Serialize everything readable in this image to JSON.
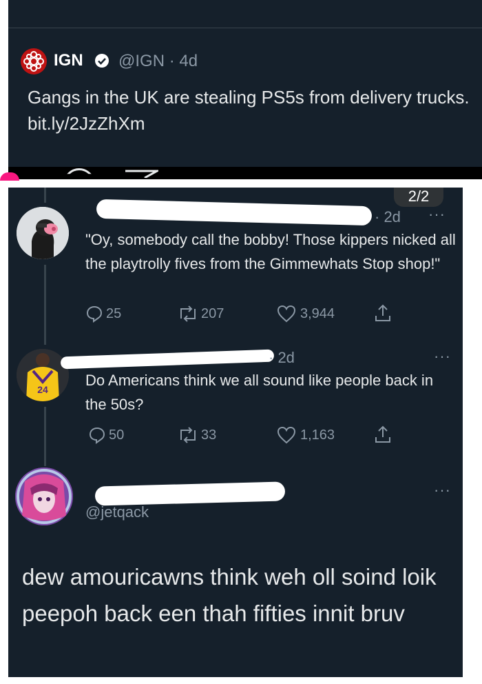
{
  "top_tweet": {
    "name": "IGN",
    "handle_time": "@IGN · 4d",
    "text": "Gangs in the UK are stealing PS5s from delivery trucks. bit.ly/2JzZhXm"
  },
  "page_counter": "2/2",
  "reply1": {
    "time": "· 2d",
    "text": "\"Oy, somebody call the bobby! Those kippers nicked all the playtrolly fives from the Gimmewhats Stop shop!\"",
    "replies": "25",
    "retweets": "207",
    "likes": "3,944"
  },
  "reply2": {
    "time": "· 2d",
    "jersey": "24",
    "text": "Do Americans think we all sound like people back in the 50s?",
    "replies": "50",
    "retweets": "33",
    "likes": "1,163"
  },
  "reply3": {
    "handle": "@jetqack",
    "text": "dew amouricawns think weh oll soind loik peepoh back een thah fifties innit bruv"
  },
  "more_label": "···",
  "colors": {
    "background": "#15202b",
    "muted": "#8b98a5",
    "brand_red": "#bf1313",
    "verified": "#ffffff"
  }
}
